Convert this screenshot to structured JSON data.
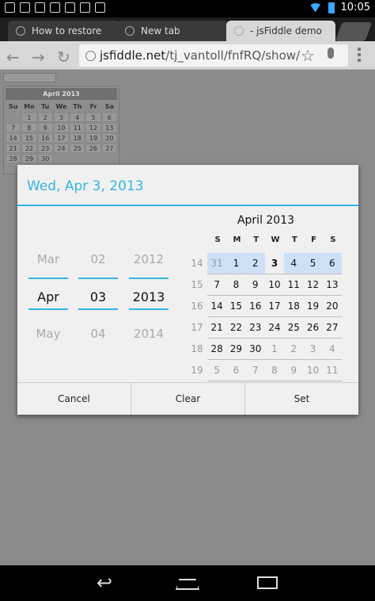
{
  "status_bar": {
    "time": "10:05"
  },
  "tabs": [
    {
      "title": "How to restore",
      "active": false
    },
    {
      "title": "New tab",
      "active": false
    },
    {
      "title": "- jsFiddle demo",
      "active": true
    }
  ],
  "toolbar": {
    "url_host": "jsfiddle.net",
    "url_path": "/tj_vantoll/fnfRQ/show/"
  },
  "page": {
    "mini_calendar": {
      "title": "April 2013",
      "weekdays": [
        "Su",
        "Mo",
        "Tu",
        "We",
        "Th",
        "Fr",
        "Sa"
      ],
      "rows": [
        [
          "",
          "1",
          "2",
          "3",
          "4",
          "5",
          "6"
        ],
        [
          "7",
          "8",
          "9",
          "10",
          "11",
          "12",
          "13"
        ],
        [
          "14",
          "15",
          "16",
          "17",
          "18",
          "19",
          "20"
        ],
        [
          "21",
          "22",
          "23",
          "24",
          "25",
          "26",
          "27"
        ],
        [
          "28",
          "29",
          "30",
          "",
          "",
          "",
          ""
        ]
      ]
    }
  },
  "dialog": {
    "title": "Wed, Apr 3, 2013",
    "month_column": [
      "Mar",
      "Apr",
      "May"
    ],
    "day_column": [
      "02",
      "03",
      "04"
    ],
    "year_column": [
      "2012",
      "2013",
      "2014"
    ],
    "calendar": {
      "title": "April 2013",
      "weekdays": [
        "S",
        "M",
        "T",
        "W",
        "T",
        "F",
        "S"
      ],
      "week_numbers": [
        "14",
        "15",
        "16",
        "17",
        "18",
        "19"
      ],
      "weeks": [
        [
          "31",
          "1",
          "2",
          "3",
          "4",
          "5",
          "6"
        ],
        [
          "7",
          "8",
          "9",
          "10",
          "11",
          "12",
          "13"
        ],
        [
          "14",
          "15",
          "16",
          "17",
          "18",
          "19",
          "20"
        ],
        [
          "21",
          "22",
          "23",
          "24",
          "25",
          "26",
          "27"
        ],
        [
          "28",
          "29",
          "30",
          "1",
          "2",
          "3",
          "4"
        ],
        [
          "5",
          "6",
          "7",
          "8",
          "9",
          "10",
          "11"
        ]
      ],
      "selected_day": "3"
    },
    "buttons": {
      "cancel": "Cancel",
      "clear": "Clear",
      "set": "Set"
    }
  },
  "colors": {
    "accent": "#33b5e5",
    "week_highlight": "#cde0f6"
  }
}
